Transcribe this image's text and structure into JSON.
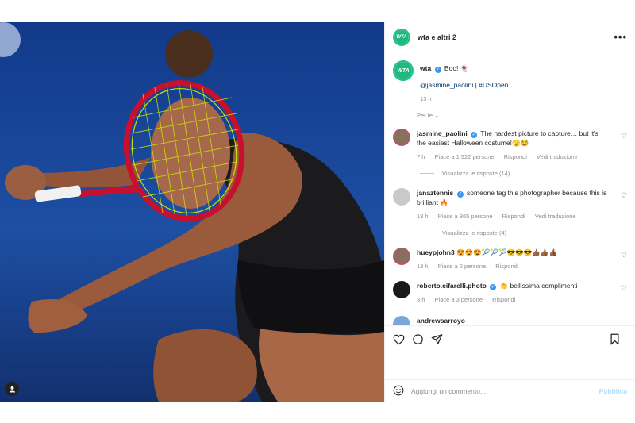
{
  "header": {
    "title": "wta e altri 2",
    "more_icon": "more-horizontal-icon"
  },
  "caption": {
    "username": "wta",
    "text": "Boo! 👻",
    "tags": "@jasmine_paolini | #USOpen",
    "time": "13 h"
  },
  "for_you": "Per te",
  "comments": [
    {
      "username": "jasmine_paolini",
      "verified": true,
      "text": "The hardest picture to capture… but it's the easiest Halloween costume!🫣😂",
      "time": "7 h",
      "likes": "Piace a 1.922 persone",
      "reply": "Rispondi",
      "translate": "Vedi traduzione",
      "replies": "Visualizza le risposte (14)"
    },
    {
      "username": "janaztennis",
      "verified": true,
      "text": "someone tag this photographer because this is brilliant 🔥",
      "time": "13 h",
      "likes": "Piace a 365 persone",
      "reply": "Rispondi",
      "translate": "Vedi traduzione",
      "replies": "Visualizza le risposte (4)"
    },
    {
      "username": "hueypjohn3",
      "verified": false,
      "text": "😍😍😍🎾🎾🎾😎😎😎👍🏾👍🏾👍🏾",
      "time": "13 h",
      "likes": "Piace a 2 persone",
      "reply": "Rispondi"
    },
    {
      "username": "roberto.cifarelli.photo",
      "verified": true,
      "text": "👏 bellissima complimenti",
      "time": "3 h",
      "likes": "Piace a 3 persone",
      "reply": "Rispondi"
    },
    {
      "username": "andrewsarroyo",
      "verified": false,
      "text": ""
    }
  ],
  "actions": {
    "like": "heart-icon",
    "comment": "comment-icon",
    "share": "share-icon",
    "save": "bookmark-icon"
  },
  "add_comment": {
    "placeholder": "Aggiungi un commento...",
    "publish": "Pubblica"
  },
  "colors": {
    "wta_green": "#1fb980",
    "verified_blue": "#3897f0",
    "publish_blue": "#b2dffc",
    "racket_red": "#c8102e",
    "strings_yellow": "#d6f000"
  }
}
